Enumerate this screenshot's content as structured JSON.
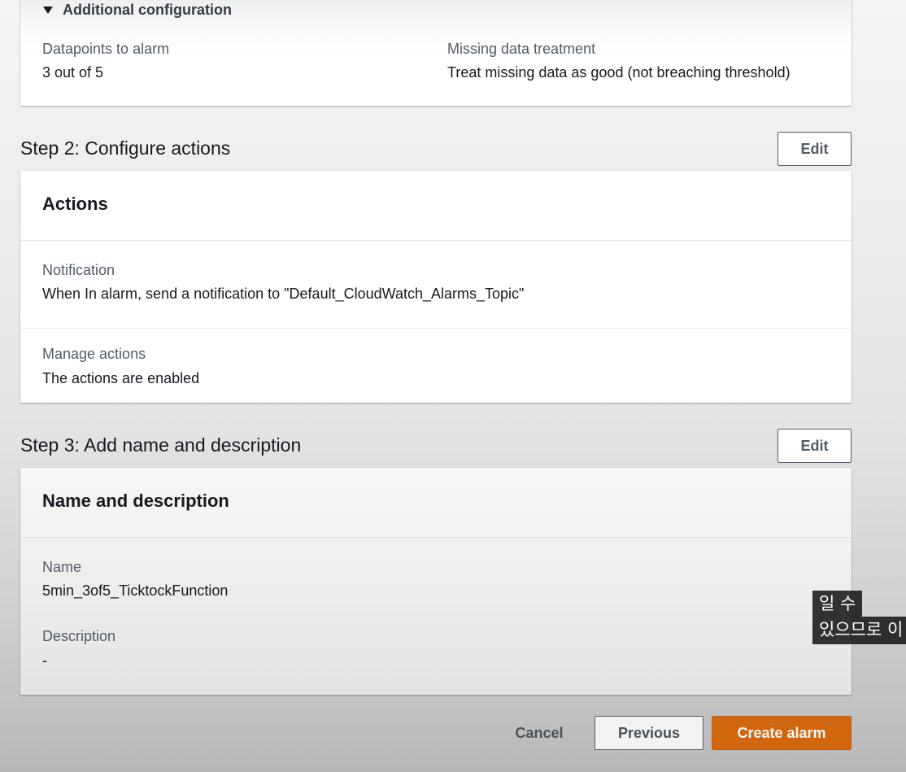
{
  "additional_config": {
    "toggle_label": "Additional configuration",
    "datapoints_label": "Datapoints to alarm",
    "datapoints_value": "3 out of 5",
    "missing_label": "Missing data treatment",
    "missing_value": "Treat missing data as good (not breaching threshold)"
  },
  "step2": {
    "title": "Step 2: Configure actions",
    "edit_label": "Edit",
    "card_title": "Actions",
    "notification_label": "Notification",
    "notification_value": "When In alarm, send a notification to \"Default_CloudWatch_Alarms_Topic\"",
    "manage_label": "Manage actions",
    "manage_value": "The actions are enabled"
  },
  "step3": {
    "title": "Step 3: Add name and description",
    "edit_label": "Edit",
    "card_title": "Name and description",
    "name_label": "Name",
    "name_value": "5min_3of5_TicktockFunction",
    "description_label": "Description",
    "description_value": "-"
  },
  "footer": {
    "cancel_label": "Cancel",
    "previous_label": "Previous",
    "create_label": "Create alarm"
  },
  "subtitle_overlay": {
    "line1": "일 수",
    "line2": "있으므로 이"
  },
  "colors": {
    "primary": "#d0670f",
    "text": "#16191f",
    "label": "#545b64"
  }
}
